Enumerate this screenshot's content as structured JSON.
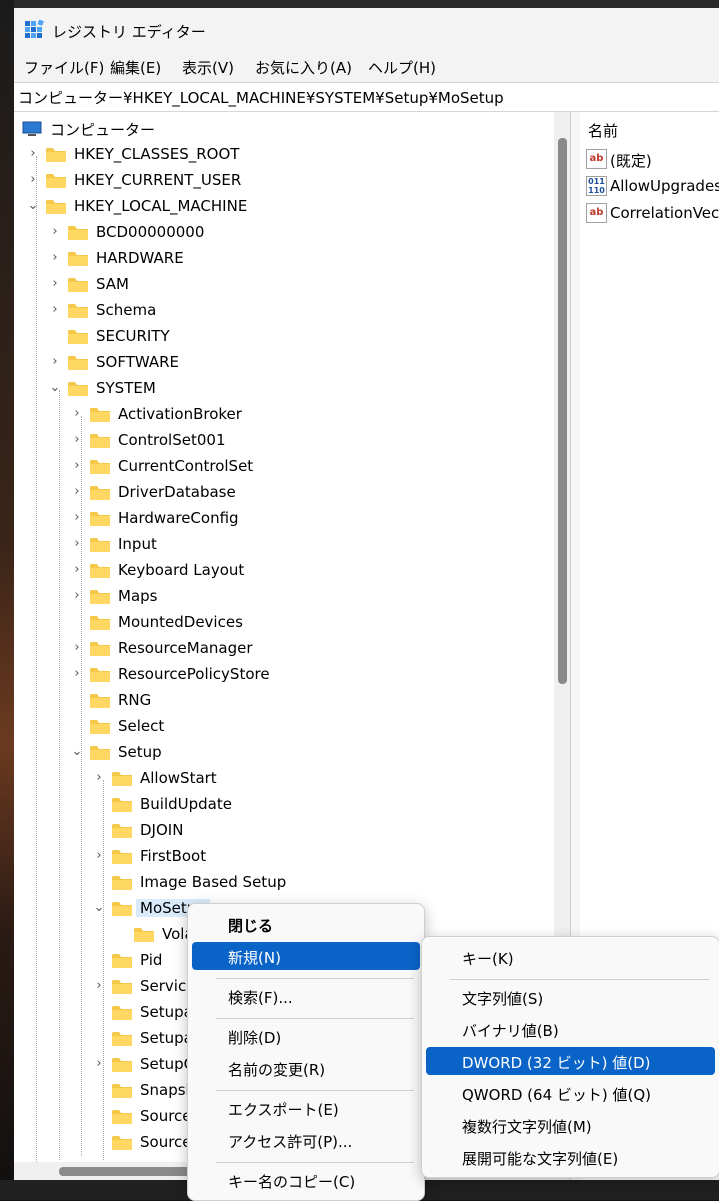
{
  "window": {
    "title": "レジストリ エディター"
  },
  "menu": [
    "ファイル(F)",
    "編集(E)",
    "表示(V)",
    "お気に入り(A)",
    "ヘルプ(H)"
  ],
  "address": "コンピューター¥HKEY_LOCAL_MACHINE¥SYSTEM¥Setup¥MoSetup",
  "tree": [
    {
      "label": "コンピューター",
      "depth": 0,
      "chev": "",
      "icon": "computer"
    },
    {
      "label": "HKEY_CLASSES_ROOT",
      "depth": 1,
      "chev": ">"
    },
    {
      "label": "HKEY_CURRENT_USER",
      "depth": 1,
      "chev": ">"
    },
    {
      "label": "HKEY_LOCAL_MACHINE",
      "depth": 1,
      "chev": "v"
    },
    {
      "label": "BCD00000000",
      "depth": 2,
      "chev": ">"
    },
    {
      "label": "HARDWARE",
      "depth": 2,
      "chev": ">"
    },
    {
      "label": "SAM",
      "depth": 2,
      "chev": ">"
    },
    {
      "label": "Schema",
      "depth": 2,
      "chev": ">"
    },
    {
      "label": "SECURITY",
      "depth": 2,
      "chev": ""
    },
    {
      "label": "SOFTWARE",
      "depth": 2,
      "chev": ">"
    },
    {
      "label": "SYSTEM",
      "depth": 2,
      "chev": "v"
    },
    {
      "label": "ActivationBroker",
      "depth": 3,
      "chev": ">"
    },
    {
      "label": "ControlSet001",
      "depth": 3,
      "chev": ">"
    },
    {
      "label": "CurrentControlSet",
      "depth": 3,
      "chev": ">"
    },
    {
      "label": "DriverDatabase",
      "depth": 3,
      "chev": ">"
    },
    {
      "label": "HardwareConfig",
      "depth": 3,
      "chev": ">"
    },
    {
      "label": "Input",
      "depth": 3,
      "chev": ">"
    },
    {
      "label": "Keyboard Layout",
      "depth": 3,
      "chev": ">"
    },
    {
      "label": "Maps",
      "depth": 3,
      "chev": ">"
    },
    {
      "label": "MountedDevices",
      "depth": 3,
      "chev": ""
    },
    {
      "label": "ResourceManager",
      "depth": 3,
      "chev": ">"
    },
    {
      "label": "ResourcePolicyStore",
      "depth": 3,
      "chev": ">"
    },
    {
      "label": "RNG",
      "depth": 3,
      "chev": ""
    },
    {
      "label": "Select",
      "depth": 3,
      "chev": ""
    },
    {
      "label": "Setup",
      "depth": 3,
      "chev": "v"
    },
    {
      "label": "AllowStart",
      "depth": 4,
      "chev": ">"
    },
    {
      "label": "BuildUpdate",
      "depth": 4,
      "chev": ""
    },
    {
      "label": "DJOIN",
      "depth": 4,
      "chev": ""
    },
    {
      "label": "FirstBoot",
      "depth": 4,
      "chev": ">"
    },
    {
      "label": "Image Based Setup",
      "depth": 4,
      "chev": ""
    },
    {
      "label": "MoSetup",
      "depth": 4,
      "chev": "v",
      "selected": true
    },
    {
      "label": "Volatile",
      "depth": 5,
      "chev": ""
    },
    {
      "label": "Pid",
      "depth": 4,
      "chev": ""
    },
    {
      "label": "Service",
      "depth": 4,
      "chev": ">"
    },
    {
      "label": "Setupa",
      "depth": 4,
      "chev": ""
    },
    {
      "label": "Setupa",
      "depth": 4,
      "chev": ""
    },
    {
      "label": "SetupC",
      "depth": 4,
      "chev": ">"
    },
    {
      "label": "Snapsh",
      "depth": 4,
      "chev": ""
    },
    {
      "label": "Source",
      "depth": 4,
      "chev": ""
    },
    {
      "label": "Source",
      "depth": 4,
      "chev": ""
    }
  ],
  "values": {
    "header": "名前",
    "items": [
      {
        "name": "(既定)",
        "type": "sz"
      },
      {
        "name": "AllowUpgrades",
        "type": "bin"
      },
      {
        "name": "CorrelationVect",
        "type": "sz"
      }
    ]
  },
  "context_menu": {
    "items": [
      {
        "label": "閉じる",
        "bold": true
      },
      {
        "label": "新規(N)",
        "submenu": true,
        "highlight": true
      },
      {
        "sep": true
      },
      {
        "label": "検索(F)..."
      },
      {
        "sep": true
      },
      {
        "label": "削除(D)"
      },
      {
        "label": "名前の変更(R)"
      },
      {
        "sep": true
      },
      {
        "label": "エクスポート(E)"
      },
      {
        "label": "アクセス許可(P)..."
      },
      {
        "sep": true
      },
      {
        "label": "キー名のコピー(C)"
      }
    ]
  },
  "submenu": {
    "items": [
      {
        "label": "キー(K)"
      },
      {
        "sep": true
      },
      {
        "label": "文字列値(S)"
      },
      {
        "label": "バイナリ値(B)"
      },
      {
        "label": "DWORD (32 ビット) 値(D)",
        "highlight": true
      },
      {
        "label": "QWORD (64 ビット) 値(Q)"
      },
      {
        "label": "複数行文字列値(M)"
      },
      {
        "label": "展開可能な文字列値(E)"
      }
    ]
  },
  "colors": {
    "highlight": "#0a64c8",
    "folder": "#f5c84a",
    "selection": "#d9ebfb"
  }
}
